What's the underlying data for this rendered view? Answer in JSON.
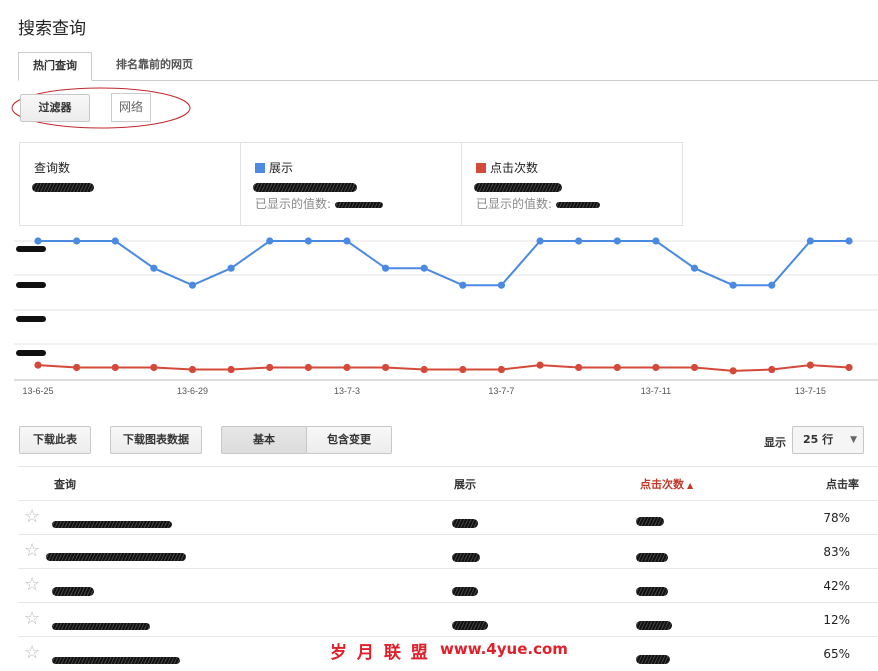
{
  "page_title": "搜索查询",
  "tabs": [
    {
      "label": "热门查询",
      "active": true
    },
    {
      "label": "排名靠前的网页",
      "active": false
    }
  ],
  "filter": {
    "button_label": "过滤器",
    "chip_label": "网络"
  },
  "stats": {
    "queries_label": "查询数",
    "impressions_label": "展示",
    "impressions_sub": "已显示的值数:",
    "clicks_label": "点击次数",
    "clicks_sub": "已显示的值数:",
    "impressions_color": "#4a8ae0",
    "clicks_color": "#d44a3a"
  },
  "chart_data": {
    "type": "line",
    "x": [
      "13-6-25",
      "13-6-26",
      "13-6-27",
      "13-6-28",
      "13-6-29",
      "13-6-30",
      "13-7-1",
      "13-7-2",
      "13-7-3",
      "13-7-4",
      "13-7-5",
      "13-7-6",
      "13-7-7",
      "13-7-8",
      "13-7-9",
      "13-7-10",
      "13-7-11",
      "13-7-12",
      "13-7-13",
      "13-7-14",
      "13-7-15",
      "13-7-16"
    ],
    "x_tick_labels": [
      "13-6-25",
      "13-6-29",
      "13-7-3",
      "13-7-7",
      "13-7-11",
      "13-7-15"
    ],
    "series": [
      {
        "name": "展示",
        "color": "#4a8ae0",
        "values": [
          4,
          4,
          4,
          3.2,
          2.7,
          3.2,
          4,
          4,
          4,
          3.2,
          3.2,
          2.7,
          2.7,
          4,
          4,
          4,
          4,
          3.2,
          2.7,
          2.7,
          4,
          4
        ]
      },
      {
        "name": "点击次数",
        "color": "#d44a3a",
        "values": [
          0.35,
          0.28,
          0.28,
          0.28,
          0.22,
          0.22,
          0.28,
          0.28,
          0.28,
          0.28,
          0.22,
          0.22,
          0.22,
          0.35,
          0.28,
          0.28,
          0.28,
          0.28,
          0.18,
          0.22,
          0.35,
          0.28
        ]
      }
    ],
    "ylim": [
      0,
      4
    ],
    "grid": true
  },
  "toolbar": {
    "download_table": "下载此表",
    "download_chart": "下载图表数据",
    "basic": "基本",
    "with_changes": "包含变更",
    "show_label": "显示",
    "rows_value": "25 行"
  },
  "table": {
    "headers": {
      "query": "查询",
      "impressions": "展示",
      "clicks": "点击次数",
      "ctr": "点击率"
    },
    "rows": [
      {
        "ctr": "78%"
      },
      {
        "ctr": "83%"
      },
      {
        "ctr": "42%"
      },
      {
        "ctr": "12%"
      },
      {
        "ctr": "65%"
      }
    ]
  },
  "watermark": {
    "text": "岁 月 联 盟",
    "url": "www.4yue.com"
  }
}
